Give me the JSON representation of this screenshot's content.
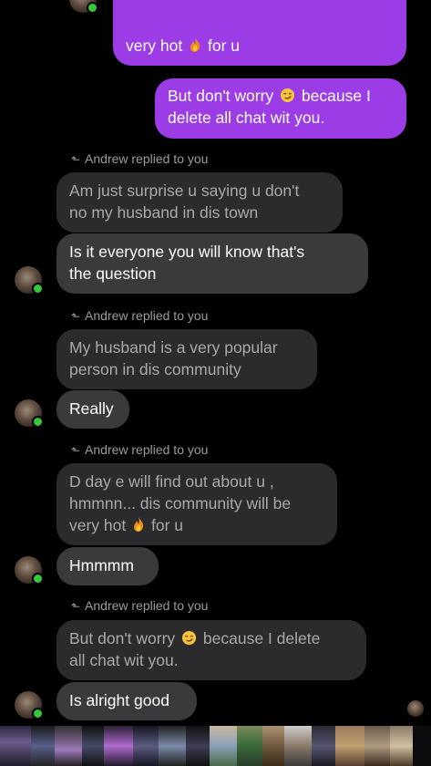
{
  "messages": {
    "sent_top": {
      "line1": "very hot",
      "line1_after": "for u"
    },
    "sent_second": {
      "line1_pre": "But don't worry",
      "line1_post": "because I",
      "line2": "delete all chat wit you."
    },
    "reply_label": "Andrew replied to you",
    "group1": {
      "quoted": [
        "Am just surprise u saying u don't",
        "no my husband in dis town"
      ],
      "reply": [
        "Is it everyone you will know that's",
        "the question"
      ]
    },
    "group2": {
      "quoted": [
        "My husband is a very popular",
        "person in dis community"
      ],
      "reply": "Really"
    },
    "group3": {
      "quoted_line1": "D day e will find out about u ,",
      "quoted_line2": "hmmnn... dis community will be",
      "quoted_line3_pre": "very hot",
      "quoted_line3_post": "for u",
      "reply": "Hmmmm"
    },
    "group4": {
      "quoted_line1_pre": "But don't worry",
      "quoted_line1_post": "because I delete",
      "quoted_line2": "all chat wit you.",
      "reply": "Is alright good"
    }
  },
  "icons": {
    "reply": "reply-arrow-icon",
    "fire": "fire-emoji",
    "smile": "smirk-emoji"
  },
  "colors": {
    "sent_bubble": "#9b3ce6",
    "received_bubble": "#3a3a3d",
    "quoted_bubble": "#2b2b2e",
    "online_dot": "#35c83f"
  }
}
